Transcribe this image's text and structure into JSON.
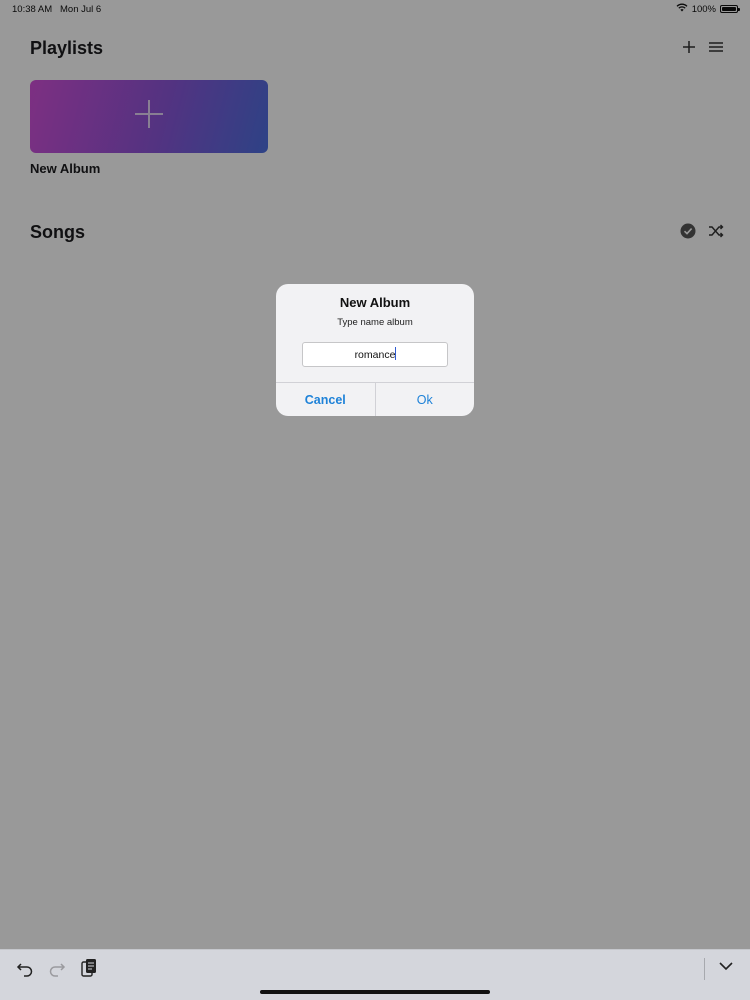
{
  "status_bar": {
    "time": "10:38 AM",
    "date": "Mon Jul 6",
    "battery": "100%",
    "battery_level": 1.0,
    "icons": [
      "wifi-icon",
      "battery-icon"
    ]
  },
  "playlists": {
    "title": "Playlists",
    "header_icons": [
      "plus-icon",
      "menu-icon"
    ],
    "albums": [
      {
        "label": "New Album",
        "icon": "plus-icon"
      }
    ]
  },
  "songs": {
    "title": "Songs",
    "header_icons": [
      "checkmark-circle-icon",
      "shuffle-icon"
    ]
  },
  "dialog": {
    "title": "New Album",
    "message": "Type name album",
    "input_value": "romance",
    "cancel_label": "Cancel",
    "ok_label": "Ok",
    "accent_color": "#1e82d8"
  },
  "keyboard_bar": {
    "icons": [
      "undo-icon",
      "redo-icon",
      "paste-icon",
      "dismiss-keyboard-icon"
    ]
  }
}
